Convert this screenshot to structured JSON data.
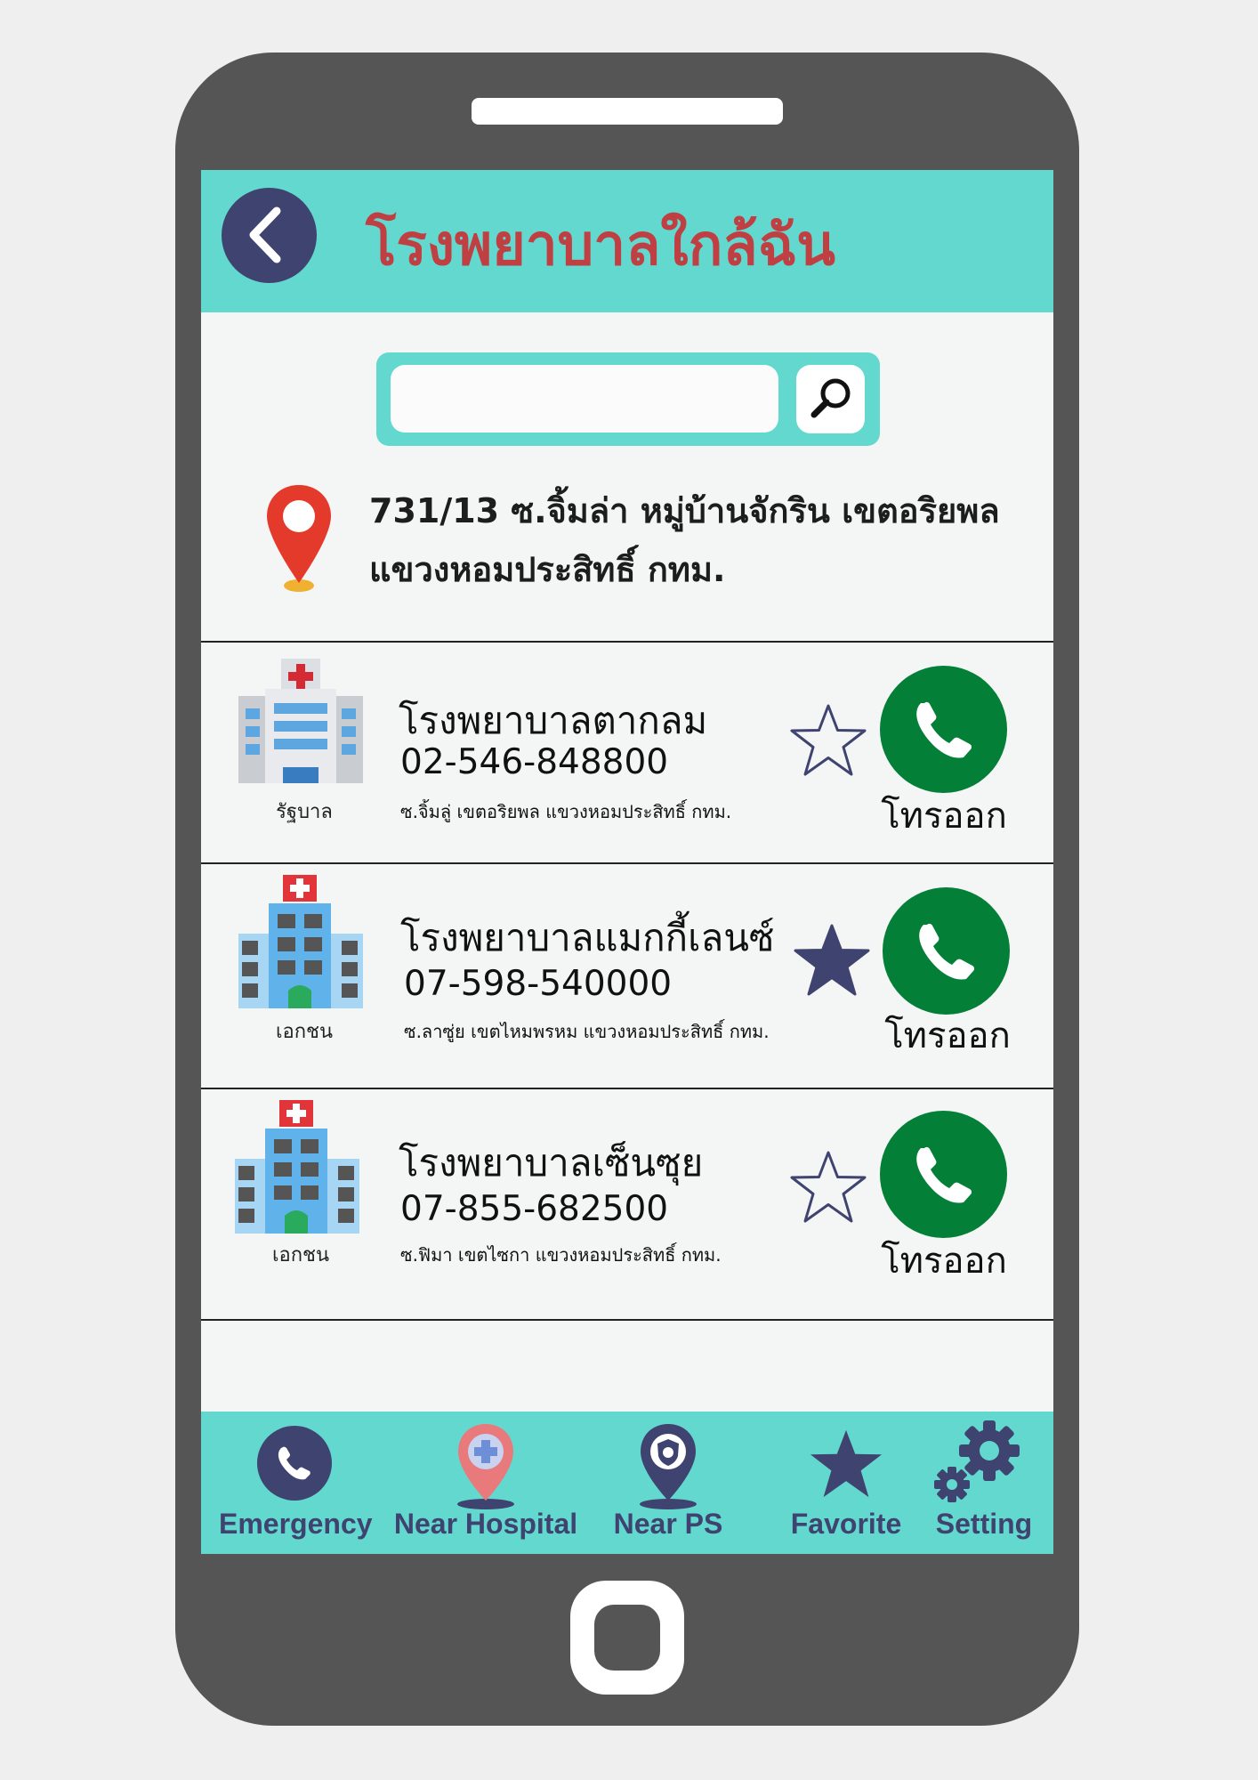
{
  "header": {
    "title": "โรงพยาบาลใกล้ฉัน",
    "back_icon": "chevron-left-icon"
  },
  "search": {
    "value": "",
    "placeholder": "",
    "icon": "search-icon"
  },
  "location": {
    "icon": "map-pin-icon",
    "address": "731/13 ซ.จิ้มล่า หมู่บ้านจักริน เขตอริยพล แขวงหอมประสิทธิ์ กทม."
  },
  "hospitals": [
    {
      "type": "รัฐบาล",
      "name": "โรงพยาบาลตากลม",
      "phone": "02-546-848800",
      "address": "ซ.จิ้มลู่ เขตอริยพล แขวงหอมประสิทธิ์ กทม.",
      "favorite": false,
      "call_label": "โทรออก"
    },
    {
      "type": "เอกชน",
      "name": "โรงพยาบาลแมกกี้เลนซ์",
      "phone": "07-598-540000",
      "address": "ซ.ลาซู่ย เขตไหมพรหม แขวงหอมประสิทธิ์ กทม.",
      "favorite": true,
      "call_label": "โทรออก"
    },
    {
      "type": "เอกชน",
      "name": "โรงพยาบาลเซ็นซุย",
      "phone": "07-855-682500",
      "address": "ซ.ฟิมา เขตไซกา แขวงหอมประสิทธิ์ กทม.",
      "favorite": false,
      "call_label": "โทรออก"
    }
  ],
  "nav": [
    {
      "label": "Emergency",
      "icon": "phone-icon"
    },
    {
      "label": "Near Hospital",
      "icon": "hospital-pin-icon"
    },
    {
      "label": "Near PS",
      "icon": "police-pin-icon"
    },
    {
      "label": "Favorite",
      "icon": "star-icon"
    },
    {
      "label": "Setting",
      "icon": "gear-icon"
    }
  ],
  "colors": {
    "accent": "#63d8cf",
    "navy": "#3f4370",
    "title": "#bf3f42",
    "call": "#037f37",
    "phone_body": "#555555"
  }
}
